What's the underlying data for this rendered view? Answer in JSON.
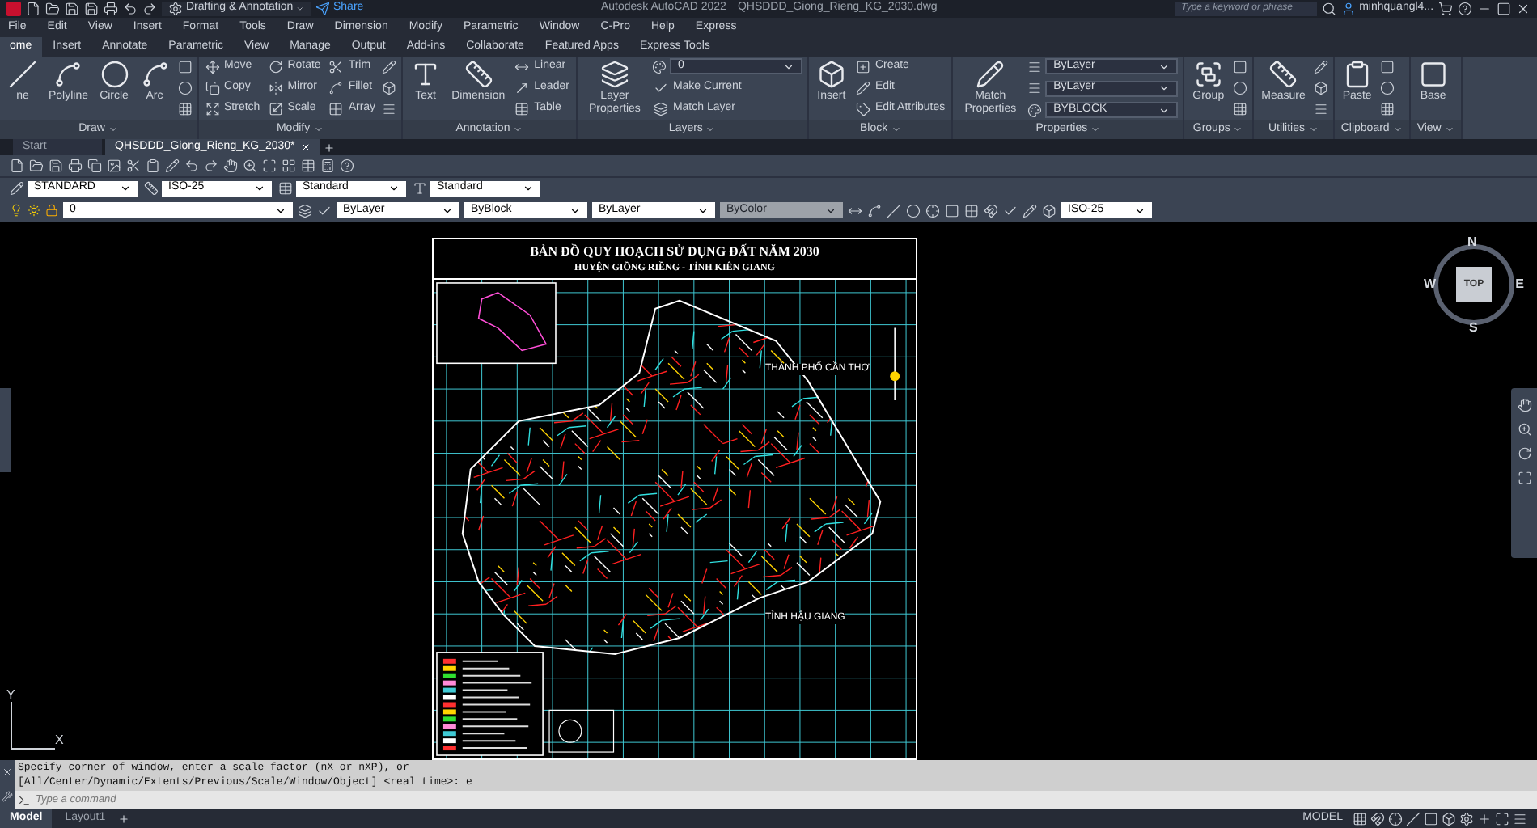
{
  "title_bar": {
    "workspace": "Drafting & Annotation",
    "share": "Share",
    "app_name": "Autodesk AutoCAD 2022",
    "file_name": "QHSDDD_Giong_Rieng_KG_2030.dwg",
    "search": {
      "placeholder": "Type a keyword or phrase"
    },
    "user": "minhquangl4..."
  },
  "menu": [
    "File",
    "Edit",
    "View",
    "Insert",
    "Format",
    "Tools",
    "Draw",
    "Dimension",
    "Modify",
    "Parametric",
    "Window",
    "C-Pro",
    "Help",
    "Express"
  ],
  "ribbon_tabs": [
    {
      "label": "ome",
      "selected": true
    },
    {
      "label": "Insert",
      "selected": false
    },
    {
      "label": "Annotate",
      "selected": false
    },
    {
      "label": "Parametric",
      "selected": false
    },
    {
      "label": "View",
      "selected": false
    },
    {
      "label": "Manage",
      "selected": false
    },
    {
      "label": "Output",
      "selected": false
    },
    {
      "label": "Add-ins",
      "selected": false
    },
    {
      "label": "Collaborate",
      "selected": false
    },
    {
      "label": "Featured Apps",
      "selected": false
    },
    {
      "label": "Express Tools",
      "selected": false
    }
  ],
  "ribbon_panels": [
    {
      "title": "Draw",
      "columns": [
        {
          "kind": "large",
          "label": "ne"
        },
        {
          "kind": "large",
          "label": "Polyline"
        },
        {
          "kind": "large",
          "label": "Circle"
        },
        {
          "kind": "large",
          "label": "Arc"
        },
        {
          "kind": "icons"
        }
      ]
    },
    {
      "title": "Modify",
      "columns": [
        {
          "kind": "stack",
          "items": [
            {
              "kind": "tool",
              "label": "Move"
            },
            {
              "kind": "tool",
              "label": "Copy"
            },
            {
              "kind": "tool",
              "label": "Stretch"
            }
          ]
        },
        {
          "kind": "stack",
          "items": [
            {
              "kind": "tool",
              "label": "Rotate"
            },
            {
              "kind": "tool",
              "label": "Mirror"
            },
            {
              "kind": "tool",
              "label": "Scale"
            }
          ]
        },
        {
          "kind": "stack",
          "items": [
            {
              "kind": "tool",
              "label": "Trim"
            },
            {
              "kind": "tool",
              "label": "Fillet"
            },
            {
              "kind": "tool",
              "label": "Array"
            }
          ]
        },
        {
          "kind": "icons"
        }
      ]
    },
    {
      "title": "Annotation",
      "columns": [
        {
          "kind": "large",
          "label": "Text"
        },
        {
          "kind": "large",
          "label": "Dimension"
        },
        {
          "kind": "stack",
          "items": [
            {
              "kind": "tool",
              "label": "Linear"
            },
            {
              "kind": "tool",
              "label": "Leader"
            },
            {
              "kind": "tool",
              "label": "Table"
            }
          ]
        }
      ]
    },
    {
      "title": "Layers",
      "columns": [
        {
          "kind": "large",
          "label": "Layer Properties"
        },
        {
          "kind": "stack",
          "items": [
            {
              "kind": "select",
              "value": "0"
            },
            {
              "kind": "tool",
              "label": "Make Current"
            },
            {
              "kind": "tool",
              "label": "Match Layer"
            }
          ]
        }
      ]
    },
    {
      "title": "Block",
      "columns": [
        {
          "kind": "large",
          "label": "Insert"
        },
        {
          "kind": "stack",
          "items": [
            {
              "kind": "tool",
              "label": "Create"
            },
            {
              "kind": "tool",
              "label": "Edit"
            },
            {
              "kind": "tool",
              "label": "Edit Attributes"
            }
          ]
        }
      ]
    },
    {
      "title": "Properties",
      "columns": [
        {
          "kind": "large",
          "label": "Match Properties"
        },
        {
          "kind": "stack",
          "items": [
            {
              "kind": "select",
              "value": "ByLayer"
            },
            {
              "kind": "select",
              "value": "ByLayer"
            },
            {
              "kind": "select",
              "value": "BYBLOCK"
            }
          ]
        }
      ]
    },
    {
      "title": "Groups",
      "columns": [
        {
          "kind": "large",
          "label": "Group"
        },
        {
          "kind": "icons"
        }
      ]
    },
    {
      "title": "Utilities",
      "columns": [
        {
          "kind": "large",
          "label": "Measure"
        },
        {
          "kind": "icons"
        }
      ]
    },
    {
      "title": "Clipboard",
      "columns": [
        {
          "kind": "large",
          "label": "Paste"
        },
        {
          "kind": "icons"
        }
      ]
    },
    {
      "title": "View",
      "columns": [
        {
          "kind": "large",
          "label": "Base"
        }
      ]
    }
  ],
  "file_tabs": [
    {
      "label": "Start",
      "selected": false
    },
    {
      "label": "QHSDDD_Giong_Rieng_KG_2030*",
      "selected": true
    }
  ],
  "style_toolbar": [
    {
      "value": "STANDARD"
    },
    {
      "value": "ISO-25"
    },
    {
      "value": "Standard"
    },
    {
      "value": "Standard"
    }
  ],
  "layer_toolbar": {
    "layer": "0",
    "selects": [
      {
        "value": "ByLayer",
        "disabled": false
      },
      {
        "value": "ByBlock",
        "disabled": false
      },
      {
        "value": "ByLayer",
        "disabled": false
      },
      {
        "value": "ByColor",
        "disabled": true
      }
    ],
    "dim_style": "ISO-25"
  },
  "drawing": {
    "title": "BẢN ĐỒ QUY HOẠCH SỬ DỤNG ĐẤT NĂM 2030",
    "subtitle": "HUYỆN GIỒNG RIỀNG - TỈNH KIÊN GIANG",
    "labels": [
      "THÀNH PHỐ CẦN THƠ",
      "TỈNH HẬU GIANG"
    ]
  },
  "viewcube": {
    "north": "N",
    "south": "S",
    "east": "E",
    "west": "W",
    "face": "TOP"
  },
  "ucs": {
    "x": "X",
    "y": "Y"
  },
  "command_line": {
    "history": [
      "Specify corner of window, enter a scale factor (nX or nXP), or",
      "[All/Center/Dynamic/Extents/Previous/Scale/Window/Object] <real time>: e"
    ],
    "placeholder": "Type a command"
  },
  "layout_tabs": [
    {
      "label": "Model",
      "selected": true
    },
    {
      "label": "Layout1",
      "selected": false
    }
  ],
  "status_bar": {
    "mode": "MODEL"
  }
}
